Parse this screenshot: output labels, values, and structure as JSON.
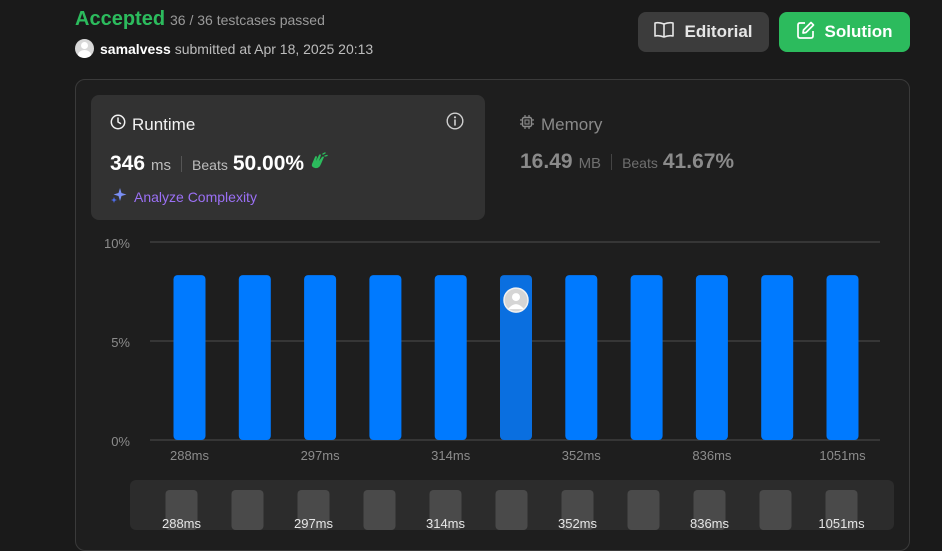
{
  "header": {
    "status": "Accepted",
    "testcases": "36 / 36 testcases passed",
    "username": "samalvess",
    "submitted_text": "submitted at Apr 18, 2025 20:13"
  },
  "buttons": {
    "editorial": "Editorial",
    "solution": "Solution"
  },
  "runtime": {
    "title": "Runtime",
    "value": "346",
    "unit": "ms",
    "beats_label": "Beats",
    "beats_value": "50.00%",
    "analyze_label": "Analyze Complexity"
  },
  "memory": {
    "title": "Memory",
    "value": "16.49",
    "unit": "MB",
    "beats_label": "Beats",
    "beats_value": "41.67%"
  },
  "colors": {
    "accepted": "#2cbb5d",
    "bar": "#007aff",
    "bar_selected": "#0a6fe0",
    "analyze": "#9b70f5"
  },
  "chart_data": {
    "type": "bar",
    "y_ticks": [
      "10%",
      "5%",
      "0%"
    ],
    "ylim": [
      0,
      10
    ],
    "x_tick_labels": [
      "288ms",
      "297ms",
      "314ms",
      "352ms",
      "836ms",
      "1051ms"
    ],
    "values": [
      8.33,
      8.33,
      8.33,
      8.33,
      8.33,
      8.33,
      8.33,
      8.33,
      8.33,
      8.33,
      8.33
    ],
    "selected_index": 5,
    "grid": true
  },
  "scroller": {
    "labels": [
      "288ms",
      "297ms",
      "314ms",
      "352ms",
      "836ms",
      "1051ms"
    ]
  }
}
